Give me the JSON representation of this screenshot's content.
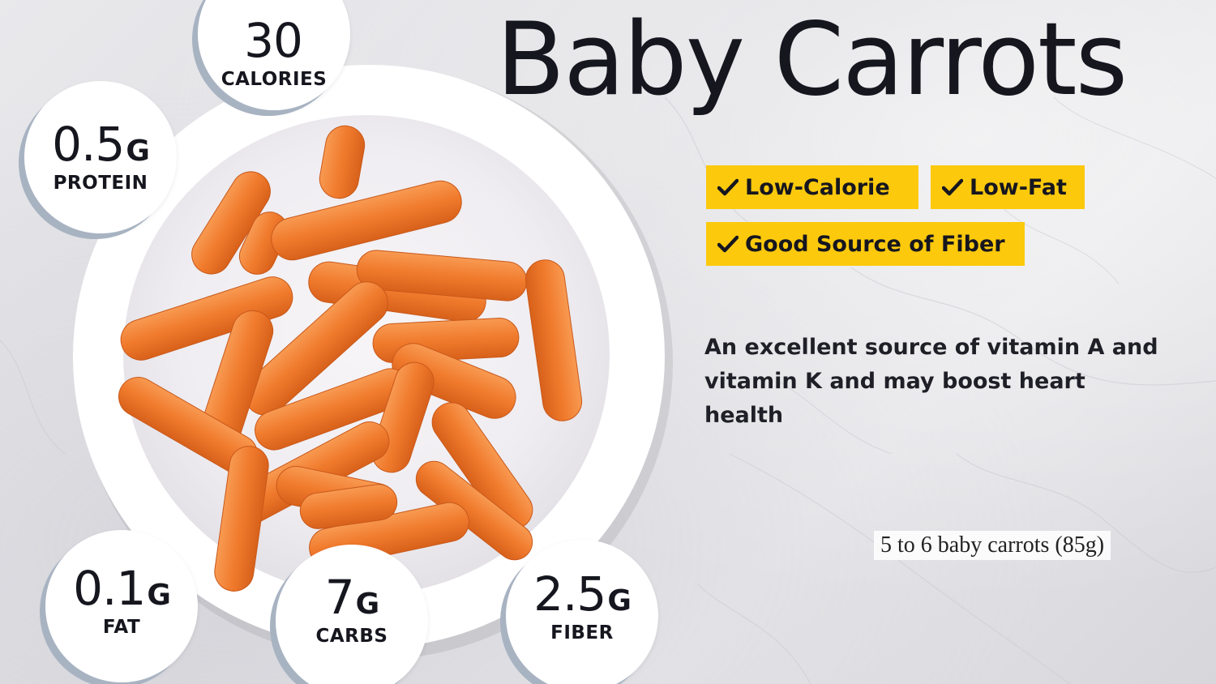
{
  "title": "Baby Carrots",
  "badges": [
    {
      "icon": "checkmark-icon",
      "label": "Low-Calorie"
    },
    {
      "icon": "checkmark-icon",
      "label": "Low-Fat"
    },
    {
      "icon": "checkmark-icon",
      "label": "Good Source of Fiber"
    }
  ],
  "description": "An excellent source of vitamin A and vitamin K and may boost heart health",
  "serving": "5 to 6 baby carrots (85g)",
  "nutrients": {
    "calories": {
      "value": "30",
      "unit": "",
      "label": "CALORIES"
    },
    "protein": {
      "value": "0.5",
      "unit": "G",
      "label": "PROTEIN"
    },
    "fat": {
      "value": "0.1",
      "unit": "G",
      "label": "FAT"
    },
    "carbs": {
      "value": "7",
      "unit": "G",
      "label": "CARBS"
    },
    "fiber": {
      "value": "2.5",
      "unit": "G",
      "label": "FIBER"
    }
  },
  "colors": {
    "badge": "#fcc90d",
    "text": "#16161f",
    "carrot": "#f07a2c",
    "plate": "#ffffff",
    "circle_shadow": "#a8b3c2"
  }
}
